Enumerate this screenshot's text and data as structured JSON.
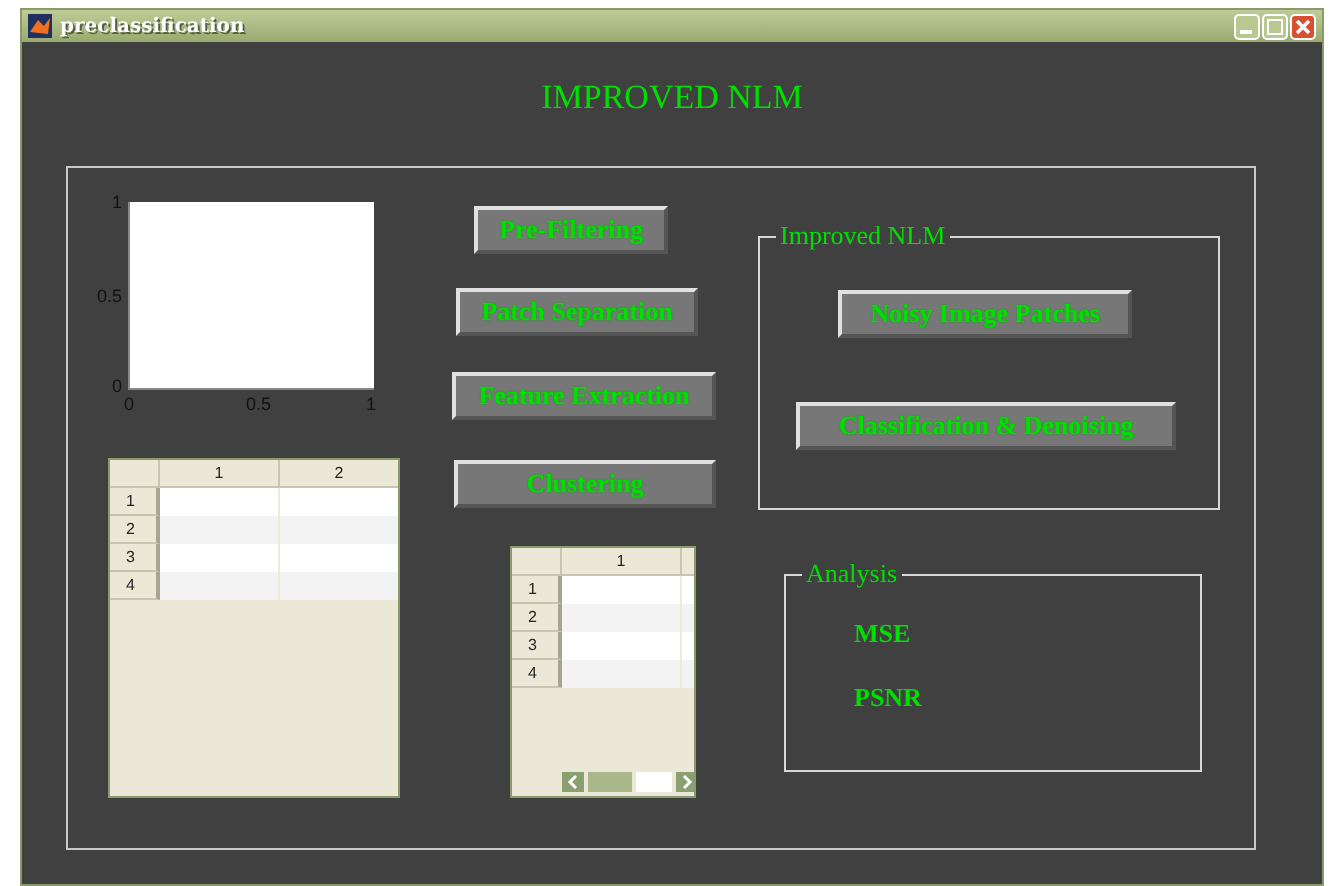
{
  "window": {
    "title": "preclassification"
  },
  "heading": "IMPROVED NLM",
  "plot": {
    "y_ticks": [
      "1",
      "0.5",
      "0"
    ],
    "x_ticks": [
      "0",
      "0.5",
      "1"
    ]
  },
  "buttons": [
    {
      "label": "Pre-Filtering"
    },
    {
      "label": "Patch Separation"
    },
    {
      "label": "Feature Extraction"
    },
    {
      "label": "Clustering"
    }
  ],
  "improved_nlm": {
    "title": "Improved NLM",
    "buttons": [
      {
        "label": "Noisy Image Patches"
      },
      {
        "label": "Classification & Denoising"
      }
    ]
  },
  "tables": [
    {
      "columns": [
        "1",
        "2"
      ],
      "row_labels": [
        "1",
        "2",
        "3",
        "4"
      ]
    },
    {
      "columns": [
        "1"
      ],
      "row_labels": [
        "1",
        "2",
        "3",
        "4"
      ]
    }
  ],
  "analysis": {
    "title": "Analysis",
    "labels": [
      "MSE",
      "PSNR"
    ]
  }
}
